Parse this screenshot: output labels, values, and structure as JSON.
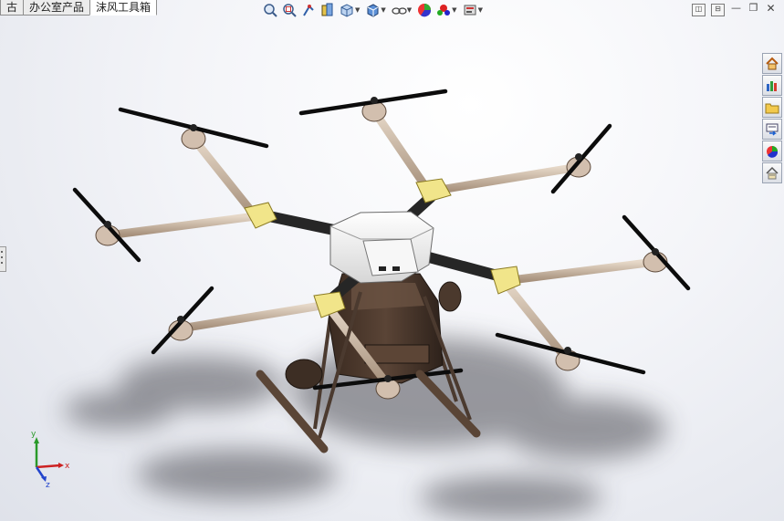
{
  "tabs": [
    {
      "label": "古"
    },
    {
      "label": "办公室产品"
    },
    {
      "label": "沫风工具箱",
      "active": true
    }
  ],
  "heads_up_toolbar": [
    {
      "icon": "zoom-to-fit-icon"
    },
    {
      "icon": "zoom-to-area-icon"
    },
    {
      "icon": "previous-view-icon"
    },
    {
      "icon": "section-view-icon"
    },
    {
      "icon": "view-orientation-icon"
    },
    {
      "icon": "display-style-icon"
    },
    {
      "icon": "hide-show-items-icon"
    },
    {
      "icon": "edit-appearance-icon"
    },
    {
      "icon": "apply-scene-icon"
    },
    {
      "icon": "view-settings-icon"
    }
  ],
  "window_controls": [
    "restore-viewport-icon",
    "tile-viewport-icon",
    "minimize-icon",
    "maximize-icon",
    "close-icon"
  ],
  "task_pane": [
    "home-icon",
    "design-library-icon",
    "file-explorer-icon",
    "view-palette-icon",
    "appearances-icon",
    "custom-properties-icon"
  ],
  "triad": {
    "x": "x",
    "y": "y",
    "z": "z"
  },
  "colors": {
    "arm": "#cdb9a5",
    "carbon": "#2a2a2a",
    "body": "#f4f4f4",
    "tank": "#4e3a2f",
    "yellow_mount": "#f1e58a",
    "prop": "#111111"
  }
}
